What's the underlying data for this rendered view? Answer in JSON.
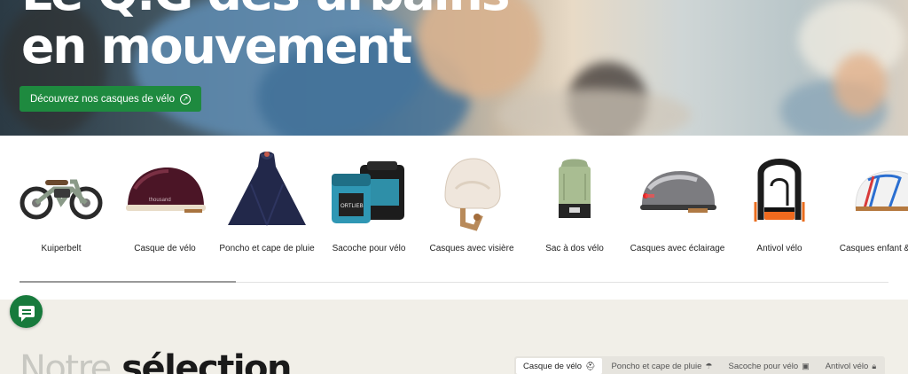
{
  "hero": {
    "title_line1": "Le Q.G des urbains",
    "title_line2": "en mouvement",
    "cta_label": "Découvrez nos casques de vélo",
    "cta_icon": "arrow-up-right-icon"
  },
  "categories": [
    {
      "label": "Kuiperbelt",
      "icon": "ebike-icon"
    },
    {
      "label": "Casque de vélo",
      "icon": "helmet-burgundy-icon"
    },
    {
      "label": "Poncho et cape de pluie",
      "icon": "poncho-icon"
    },
    {
      "label": "Sacoche pour vélo",
      "icon": "bike-panniers-icon"
    },
    {
      "label": "Casques avec visière",
      "icon": "visor-helmet-icon"
    },
    {
      "label": "Sac à dos vélo",
      "icon": "backpack-icon"
    },
    {
      "label": "Casques avec éclairage",
      "icon": "light-helmet-icon"
    },
    {
      "label": "Antivol vélo",
      "icon": "u-lock-icon"
    },
    {
      "label": "Casques enfant & bébé",
      "icon": "kids-helmet-icon"
    }
  ],
  "category_scroll": {
    "position": 0.25
  },
  "selection": {
    "title_light": "Notre",
    "title_bold": "sélection",
    "tabs": [
      {
        "label": "Casque de vélo",
        "icon": "helmet-icon",
        "active": true
      },
      {
        "label": "Poncho et cape de pluie",
        "icon": "umbrella-icon",
        "active": false
      },
      {
        "label": "Sacoche pour vélo",
        "icon": "bag-icon",
        "active": false
      },
      {
        "label": "Antivol vélo",
        "icon": "lock-icon",
        "active": false
      }
    ]
  },
  "chat": {
    "icon": "chat-icon"
  },
  "colors": {
    "brand_green": "#1e8a3f",
    "section_bg": "#f1efe8"
  }
}
